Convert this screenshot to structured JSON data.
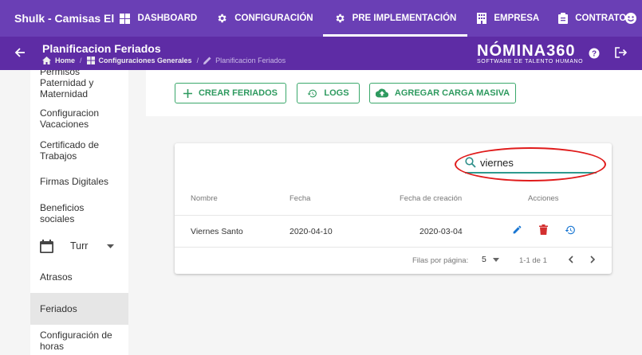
{
  "app": {
    "brand": "Shulk - Camisas El"
  },
  "nav": [
    {
      "label": "DASHBOARD",
      "icon": "dashboard-icon"
    },
    {
      "label": "CONFIGURACIÓN",
      "icon": "gear-icon"
    },
    {
      "label": "PRE IMPLEMENTACIÓN",
      "icon": "gear-icon"
    },
    {
      "label": "EMPRESA",
      "icon": "building-icon"
    },
    {
      "label": "CONTRATOS",
      "icon": "clipboard-icon"
    }
  ],
  "header": {
    "title": "Planificacion Feriados",
    "breadcrumb": [
      "Home",
      "Configuraciones Generales",
      "Planificacion Feriados"
    ],
    "logo_main": "NÓMINA360",
    "logo_sub": "SOFTWARE DE TALENTO HUMANO"
  },
  "sidebar": {
    "items": [
      "Permisos Paternidad y Maternidad",
      "Configuracion Vacaciones",
      "Certificado de Trabajos",
      "Firmas Digitales",
      "Beneficios sociales",
      "Turr",
      "Atrasos",
      "Feriados",
      "Configuración de horas"
    ]
  },
  "toolbar": {
    "create": "CREAR FERIADOS",
    "logs": "LOGS",
    "bulk": "AGREGAR CARGA MASIVA"
  },
  "search": {
    "value": "viernes"
  },
  "table": {
    "headers": [
      "Nombre",
      "Fecha",
      "Fecha de creación",
      "Acciones"
    ],
    "rows": [
      {
        "nombre": "Viernes Santo",
        "fecha": "2020-04-10",
        "creacion": "2020-03-04"
      }
    ],
    "rows_per_page_label": "Filas por página:",
    "rows_per_page": "5",
    "range": "1-1 de 1"
  },
  "colors": {
    "nav": "#6a3fb5",
    "subheader": "#5e2ca5",
    "accent": "#3aa86b",
    "edit": "#1976d2",
    "delete": "#d32f2f",
    "highlight": "#e01b1b"
  }
}
